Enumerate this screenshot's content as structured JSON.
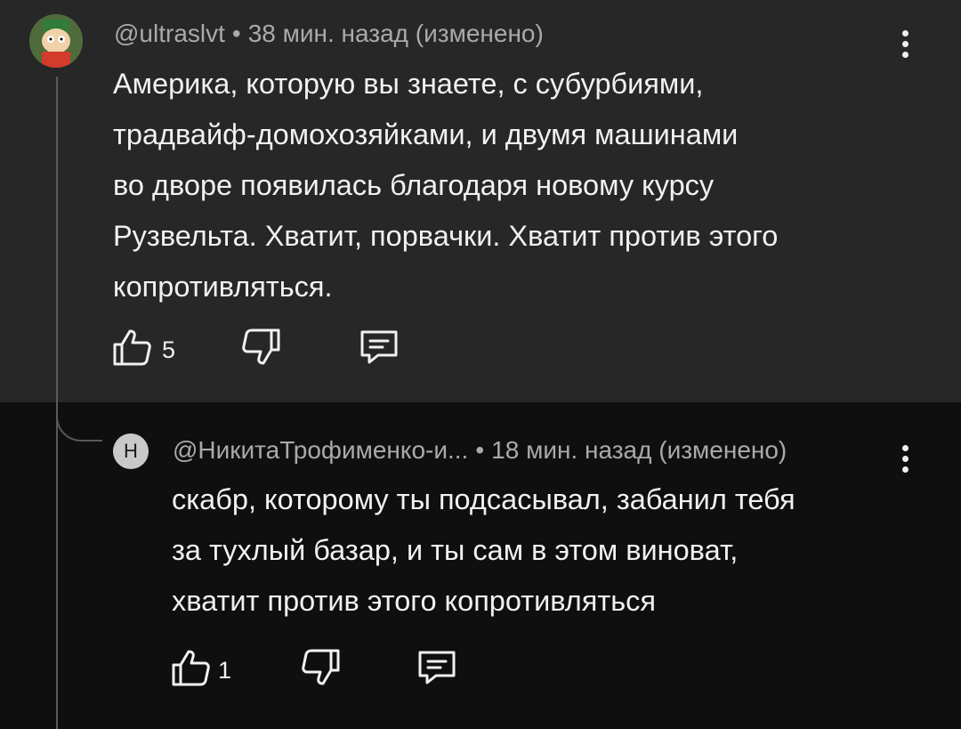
{
  "parent_comment": {
    "author": "@ultraslvt",
    "time": "38 мин. назад (изменено)",
    "text_lines": [
      "Америка, которую вы знаете, с субурбиями,",
      "традвайф-домохозяйками, и двумя машинами",
      "во дворе появилась благодаря новому курсу",
      "Рузвельта. Хватит, порвачки. Хватит против этого",
      "копротивляться."
    ],
    "like_count": "5"
  },
  "reply_comment": {
    "avatar_letter": "Н",
    "author": "@НикитаТрофименко-и...",
    "time": "18 мин. назад (изменено)",
    "text_lines": [
      "скабр, которому ты подсасывал, забанил тебя",
      "за тухлый базар, и ты сам в этом виноват,",
      "хватит против этого копротивляться"
    ],
    "like_count": "1"
  },
  "separator": "•",
  "icons": [
    "like-icon",
    "dislike-icon",
    "reply-icon",
    "more-vert-icon"
  ],
  "colors": {
    "parent_bg": "#272727",
    "reply_bg": "#0f0f0f",
    "text": "#f1f1f1",
    "meta": "#aaaaaa"
  }
}
